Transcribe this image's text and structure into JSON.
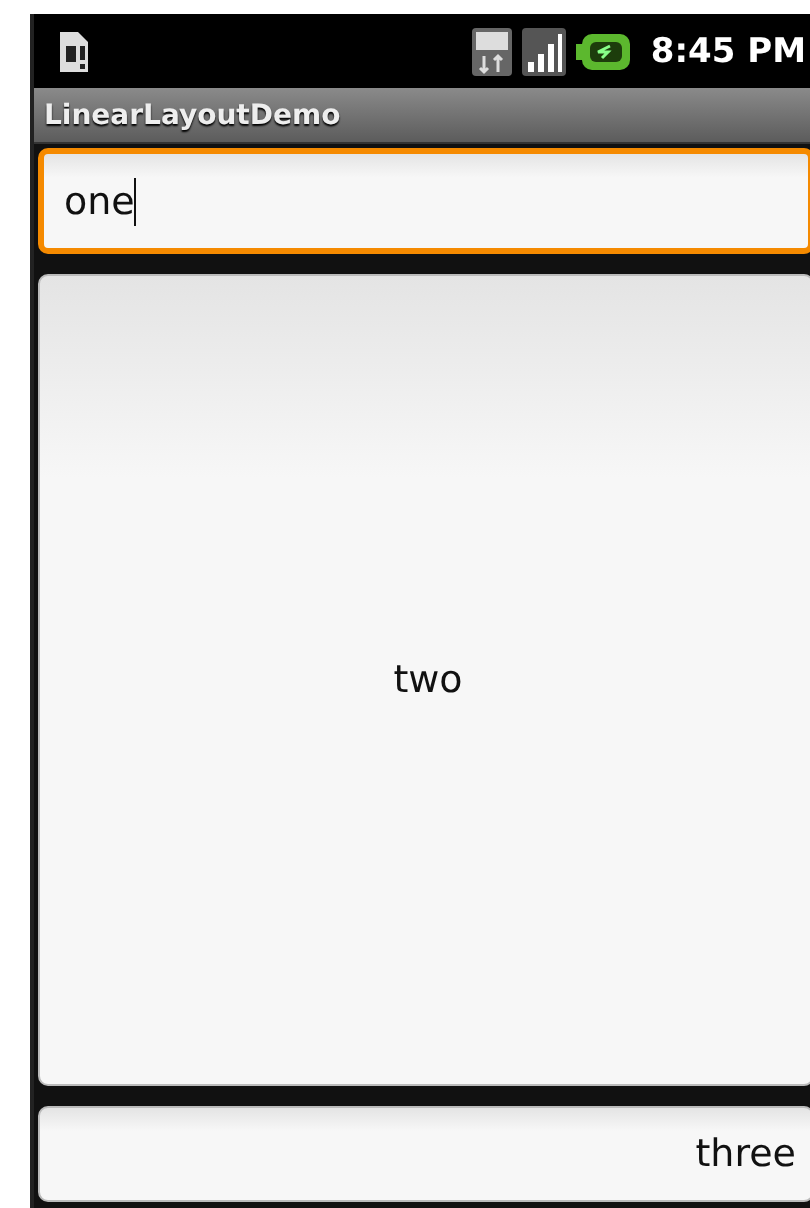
{
  "status_bar": {
    "time": "8:45 PM"
  },
  "title_bar": {
    "title": "LinearLayoutDemo"
  },
  "fields": [
    {
      "value": "one",
      "focused": true
    },
    {
      "value": "two",
      "focused": false
    },
    {
      "value": "three",
      "focused": false
    }
  ]
}
